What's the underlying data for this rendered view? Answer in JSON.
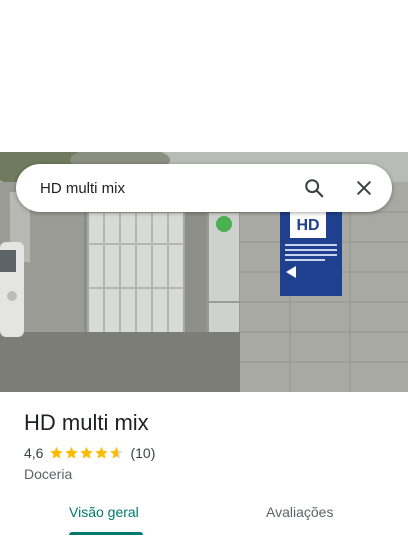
{
  "search": {
    "query": "HD multi mix",
    "search_icon": "search-icon",
    "close_icon": "close-icon"
  },
  "place": {
    "name": "HD multi mix",
    "rating_value": "4,6",
    "rating_stars": 4.6,
    "review_count": "(10)",
    "category": "Doceria"
  },
  "tabs": [
    {
      "label": "Visão geral",
      "selected": true
    },
    {
      "label": "Avaliações",
      "selected": false
    }
  ],
  "photo": {
    "sign_logo": "HD",
    "sign_subtitle": "MULTI MIX"
  },
  "colors": {
    "accent": "#00796b",
    "star": "#fbbc04",
    "star_empty": "#dadce0"
  }
}
